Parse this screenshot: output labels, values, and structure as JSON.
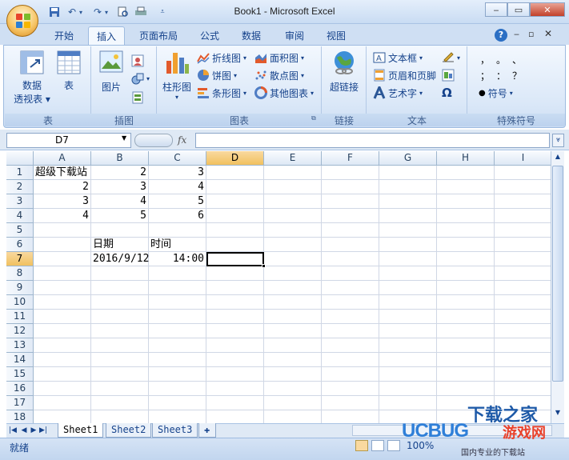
{
  "window": {
    "title": "Book1 - Microsoft Excel"
  },
  "tabs": [
    "开始",
    "插入",
    "页面布局",
    "公式",
    "数据",
    "审阅",
    "视图"
  ],
  "active_tab": "插入",
  "ribbon": {
    "groups": {
      "table": {
        "label": "表",
        "pivot_line1": "数据",
        "pivot_line2": "透视表",
        "table_button": "表"
      },
      "illustrations": {
        "label": "插图",
        "picture_button": "图片"
      },
      "charts": {
        "label": "图表",
        "column_chart": "柱形图",
        "line_chart": "折线图",
        "pie_chart": "饼图",
        "bar_chart": "条形图",
        "area_chart": "面积图",
        "scatter_chart": "散点图",
        "other_charts": "其他图表"
      },
      "links": {
        "label": "链接",
        "hyperlink_button": "超链接"
      },
      "text": {
        "label": "文本",
        "textbox": "文本框",
        "header_footer": "页眉和页脚",
        "wordart": "艺术字"
      },
      "symbols": {
        "label": "特殊符号",
        "symbol_button": "符号",
        "glyphs": [
          "，",
          "。",
          "、",
          "；",
          "：",
          "？"
        ],
        "omega": "Ω"
      }
    }
  },
  "formula_bar": {
    "name_box": "D7",
    "fx_label": "fx",
    "formula": ""
  },
  "sheet": {
    "columns": [
      "A",
      "B",
      "C",
      "D",
      "E",
      "F",
      "G",
      "H",
      "I"
    ],
    "rows": [
      "1",
      "2",
      "3",
      "4",
      "5",
      "6",
      "7",
      "8",
      "9",
      "10",
      "11",
      "12",
      "13",
      "14",
      "15",
      "16",
      "17",
      "18"
    ],
    "selected_cell": "D7",
    "cells": {
      "A1": "超级下载站",
      "B1": "2",
      "C1": "3",
      "A2": "2",
      "B2": "3",
      "C2": "4",
      "A3": "3",
      "B3": "4",
      "C3": "5",
      "A4": "4",
      "B4": "5",
      "C4": "6",
      "B6": "日期",
      "C6": "时间",
      "B7": "2016/9/12",
      "C7": "14:00"
    }
  },
  "sheet_tabs": [
    "Sheet1",
    "Sheet2",
    "Sheet3"
  ],
  "active_sheet": "Sheet1",
  "status": {
    "ready": "就绪",
    "zoom": "100%"
  },
  "watermark": {
    "brand": "UCBUG",
    "text1": "下载之家",
    "text2": "游戏网",
    "url": "国内专业的下载站"
  }
}
